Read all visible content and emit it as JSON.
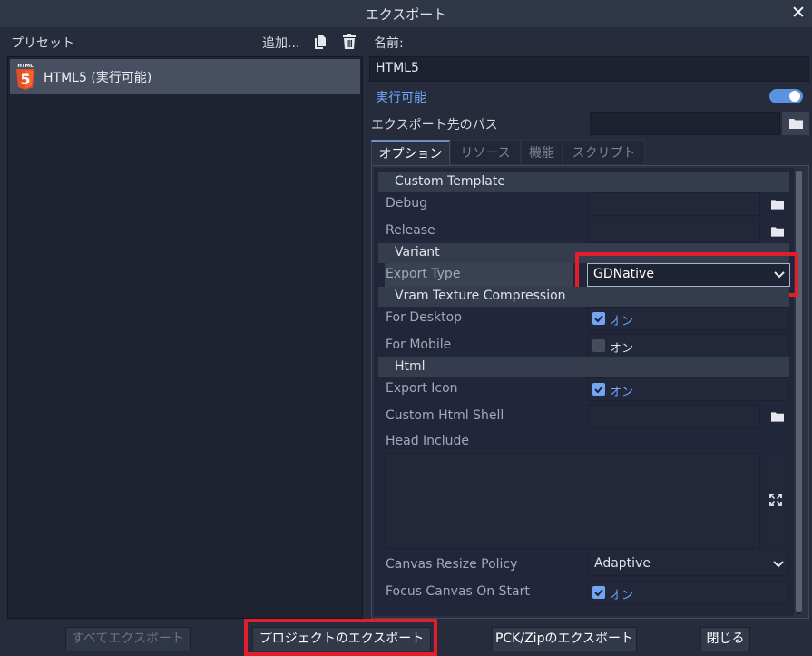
{
  "window": {
    "title": "エクスポート",
    "close_icon": "close-icon"
  },
  "presets": {
    "label": "プリセット",
    "add_label": "追加...",
    "items": [
      {
        "label": "HTML5 (実行可能)",
        "icon": "html5-icon",
        "icon_text": "HTML",
        "icon_number": "5"
      }
    ]
  },
  "details": {
    "name_label": "名前:",
    "name_value": "HTML5",
    "runnable_label": "実行可能",
    "runnable_on": true,
    "export_path_label": "エクスポート先のパス",
    "export_path_value": ""
  },
  "tabs": [
    {
      "label": "オプション",
      "active": true
    },
    {
      "label": "リソース",
      "active": false
    },
    {
      "label": "機能",
      "active": false
    },
    {
      "label": "スクリプト",
      "active": false
    }
  ],
  "options": {
    "section_custom_template": "Custom Template",
    "debug_label": "Debug",
    "release_label": "Release",
    "section_variant": "Variant",
    "export_type_label": "Export Type",
    "export_type_value": "GDNative",
    "section_vram": "Vram Texture Compression",
    "for_desktop_label": "For Desktop",
    "for_desktop_value": "オン",
    "for_mobile_label": "For Mobile",
    "for_mobile_value": "オン",
    "section_html": "Html",
    "export_icon_label": "Export Icon",
    "export_icon_value": "オン",
    "custom_html_shell_label": "Custom Html Shell",
    "head_include_label": "Head Include",
    "canvas_resize_label": "Canvas Resize Policy",
    "canvas_resize_value": "Adaptive",
    "focus_canvas_label": "Focus Canvas On Start",
    "focus_canvas_value": "オン"
  },
  "buttons": {
    "export_all": "すべてエクスポート",
    "export_project": "プロジェクトのエクスポート",
    "export_pck": "PCK/Zipのエクスポート",
    "close": "閉じる"
  },
  "colors": {
    "accent": "#6fa8ff",
    "highlight_red": "#e11f2c",
    "html5_orange": "#e44d26"
  }
}
